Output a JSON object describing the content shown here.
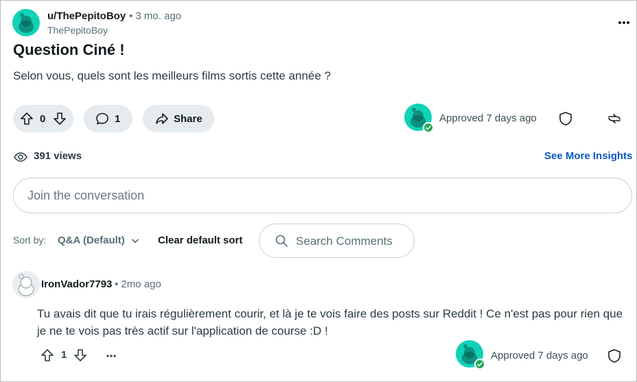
{
  "post": {
    "author": "u/ThePepitoBoy",
    "time": "• 3 mo. ago",
    "handle": "ThePepitoBoy",
    "title": "Question Ciné !",
    "body": "Selon vous, quels sont les meilleurs films sortis cette année ?",
    "score": "0",
    "comment_count": "1",
    "share_label": "Share",
    "approved": "Approved 7 days ago",
    "views": "391 views",
    "insights_link": "See More Insights",
    "avatar_color": "#10d2b6"
  },
  "composer": {
    "placeholder": "Join the conversation"
  },
  "sort": {
    "label": "Sort by:",
    "value": "Q&A (Default)",
    "clear": "Clear default sort",
    "search_placeholder": "Search Comments"
  },
  "comment": {
    "author": "IronVador7793",
    "time": "• 2mo ago",
    "text": "Tu avais dit que tu irais régulièrement courir, et là je te vois faire des posts sur Reddit ! Ce n'est pas pour rien que je ne te vois pas très actif sur l'application de course :D !",
    "score": "1",
    "approved": "Approved 7 days ago"
  },
  "icons": {
    "upvote": "upvote-arrow-icon",
    "downvote": "downvote-arrow-icon",
    "comment": "speech-bubble-icon",
    "share": "share-arrow-icon",
    "shield": "shield-icon",
    "mod": "mod-tools-icon",
    "views": "eye-views-icon",
    "search": "search-icon",
    "chevron": "chevron-down-icon",
    "more": "ellipsis-icon",
    "approved_check": "check-badge-icon"
  },
  "colors": {
    "pill_bg": "#e5ebee",
    "link": "#0a56c2",
    "approved_green": "#23a559"
  }
}
